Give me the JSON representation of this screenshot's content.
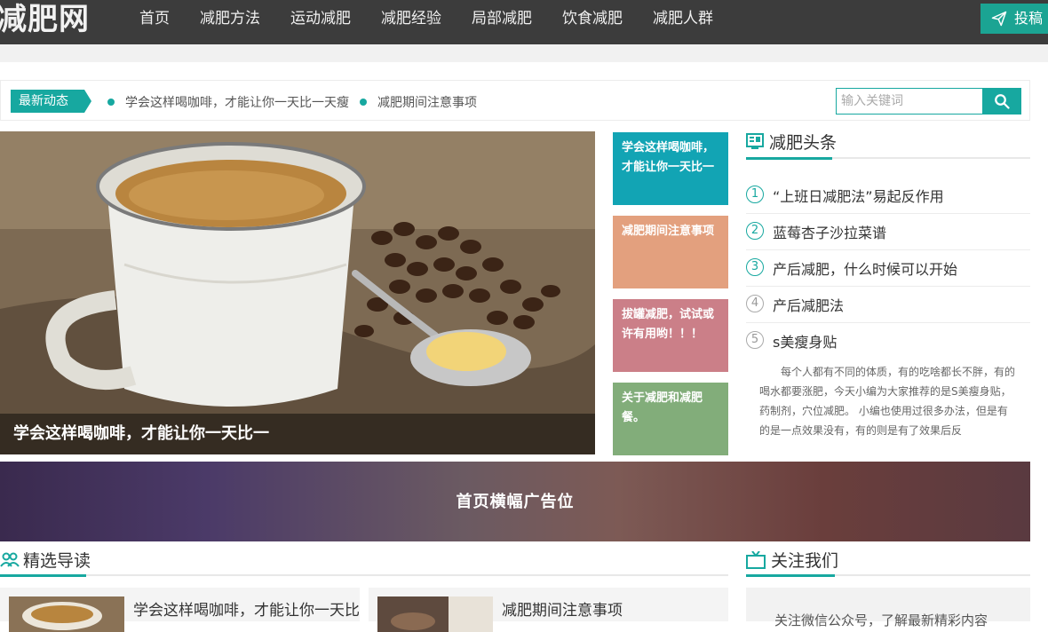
{
  "header": {
    "logo": "减肥网",
    "nav": [
      "首页",
      "减肥方法",
      "运动减肥",
      "减肥经验",
      "局部减肥",
      "饮食减肥",
      "减肥人群"
    ],
    "submit_label": "投稿"
  },
  "ticker": {
    "badge": "最新动态",
    "items": [
      "学会这样喝咖啡，才能让你一天比一天瘦",
      "减肥期间注意事项"
    ],
    "search_placeholder": "输入关键词"
  },
  "hero": {
    "caption": "学会这样喝咖啡，才能让你一天比一"
  },
  "tiles": [
    {
      "text": "学会这样喝咖啡，才能让你一天比一",
      "color": "#12a4b4"
    },
    {
      "text": "减肥期间注意事项",
      "color": "#e3a07e"
    },
    {
      "text": "拔罐减肥，试试或许有用哟！！！",
      "color": "#cb7f88"
    },
    {
      "text": "关于减肥和减肥餐。",
      "color": "#82ad7a"
    }
  ],
  "headlines": {
    "title": "减肥头条",
    "items": [
      {
        "num": "1",
        "text": "“上班日减肥法”易起反作用"
      },
      {
        "num": "2",
        "text": "蓝莓杏子沙拉菜谱"
      },
      {
        "num": "3",
        "text": "产后减肥，什么时候可以开始"
      },
      {
        "num": "4",
        "text": "产后减肥法"
      },
      {
        "num": "5",
        "text": "s美瘦身贴"
      }
    ],
    "desc": "每个人都有不同的体质，有的吃啥都长不胖，有的喝水都要涨肥，今天小编为大家推荐的是S美瘦身贴， 药制剂，穴位减肥。 小编也使用过很多办法，但是有的是一点效果没有，有的则是有了效果后反"
  },
  "banner": {
    "text": "首页横幅广告位"
  },
  "featured": {
    "title": "精选导读",
    "cards": [
      {
        "title": "学会这样喝咖啡，才能让你一天比"
      },
      {
        "title": "减肥期间注意事项"
      }
    ]
  },
  "follow": {
    "title": "关注我们",
    "text": "关注微信公众号，了解最新精彩内容"
  },
  "colors": {
    "accent": "#17a8a0",
    "header_bg": "#3c3c3c"
  }
}
